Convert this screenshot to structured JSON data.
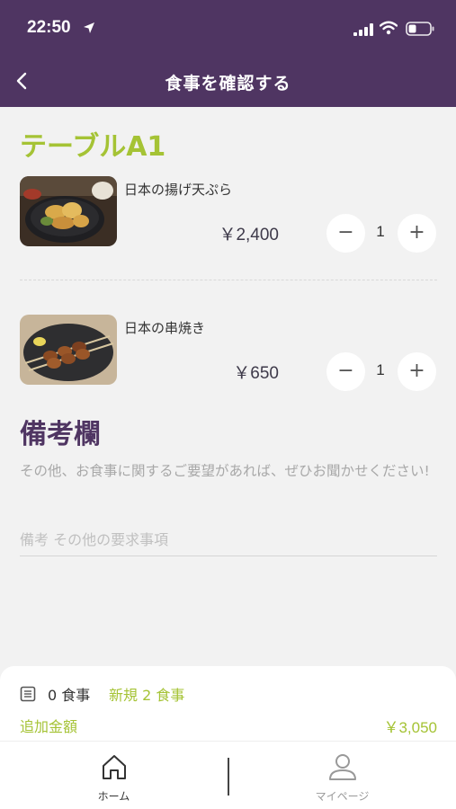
{
  "status_bar": {
    "time": "22:50"
  },
  "header": {
    "title": "食事を確認する"
  },
  "table": {
    "name": "テーブルA1"
  },
  "order_items": [
    {
      "name": "日本の揚げ天ぷら",
      "price": "￥2,400",
      "quantity": "1",
      "image": "tempura-photo"
    },
    {
      "name": "日本の串焼き",
      "price": "￥650",
      "quantity": "1",
      "image": "yakitori-photo"
    }
  ],
  "stepper": {
    "minus": "−",
    "plus": "+"
  },
  "remarks": {
    "title": "備考欄",
    "hint": "その他、お食事に関するご要望があれば、ぜひお聞かせください!",
    "placeholder": "備考 その他の要求事項",
    "value": ""
  },
  "summary": {
    "ordered_count": "0 食事",
    "new_count": "新規 2 食事",
    "additional_label": "追加金額",
    "additional_amount": "￥3,050"
  },
  "tabs": [
    {
      "label": "ホーム",
      "icon": "home-icon",
      "active": true
    },
    {
      "label": "マイページ",
      "icon": "person-icon",
      "active": false
    }
  ],
  "colors": {
    "brand": "#4f3562",
    "accent": "#a5c335",
    "background": "#f2f2f2"
  }
}
